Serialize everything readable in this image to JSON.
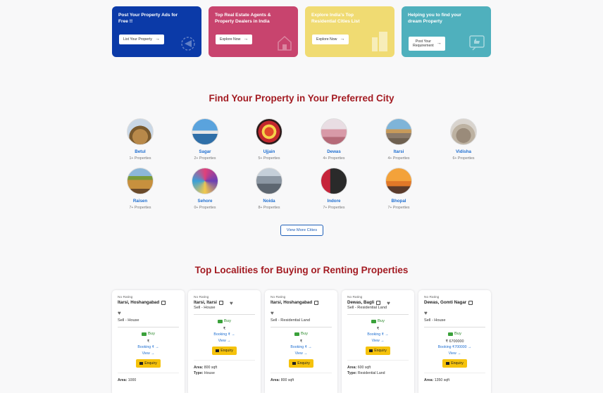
{
  "promos": [
    {
      "title": "Post Your Property Ads for Free !!",
      "button": "List Your Property",
      "color": "#0b3aa8"
    },
    {
      "title": "Top Real Estate Agents & Property Dealers in India",
      "button": "Explore Now",
      "color": "#c8446e"
    },
    {
      "title": "Explore India's Top Residential Cities List",
      "button": "Explore Now",
      "color": "#f0db72"
    },
    {
      "title": "Helping you to find your dream Property",
      "button": "Post Your Requirement",
      "color": "#4fb0bd"
    }
  ],
  "cities_section": {
    "title": "Find Your Property in Your Preferred City",
    "view_more": "View More Cities",
    "cities": [
      {
        "name": "Betul",
        "count": "1+ Properties"
      },
      {
        "name": "Sagar",
        "count": "2+ Properties"
      },
      {
        "name": "Ujjain",
        "count": "5+ Properties"
      },
      {
        "name": "Dewas",
        "count": "4+ Properties"
      },
      {
        "name": "Itarsi",
        "count": "4+ Properties"
      },
      {
        "name": "Vidisha",
        "count": "6+ Properties"
      },
      {
        "name": "Raisen",
        "count": "7+ Properties"
      },
      {
        "name": "Sehore",
        "count": "0+ Properties"
      },
      {
        "name": "Noida",
        "count": "8+ Properties"
      },
      {
        "name": "Indore",
        "count": "7+ Properties"
      },
      {
        "name": "Bhopal",
        "count": "7+ Properties"
      }
    ]
  },
  "localities_section": {
    "title": "Top Localities for Buying or Renting Properties",
    "cards": [
      {
        "rating": "No Rating",
        "location": "Itarsi, Hoshangabad",
        "type": "Sell - House",
        "buy": "Buy",
        "price": "₹",
        "booking": "Booking ₹",
        "view": "View",
        "enquiry": "Enquiry",
        "attr1_label": "Area:",
        "attr1_value": "1000",
        "attr2_label": "",
        "attr2_value": ""
      },
      {
        "rating": "No Rating",
        "location": "Itarsi, Itarsi",
        "type": "Sell - House",
        "buy": "Buy",
        "price": "₹",
        "booking": "Booking ₹",
        "view": "View",
        "enquiry": "Enquiry",
        "attr1_label": "Area:",
        "attr1_value": "800 sqft",
        "attr2_label": "Type:",
        "attr2_value": "House"
      },
      {
        "rating": "No Rating",
        "location": "Itarsi, Hoshangabad",
        "type": "Sell - Residential Land",
        "buy": "Buy",
        "price": "₹",
        "booking": "Booking ₹",
        "view": "View",
        "enquiry": "Enquiry",
        "attr1_label": "Area:",
        "attr1_value": "800 sqft",
        "attr2_label": "",
        "attr2_value": ""
      },
      {
        "rating": "No Rating",
        "location": "Dewas, Bagli",
        "type": "Sell - Residential Land",
        "buy": "Buy",
        "price": "₹",
        "booking": "Booking ₹",
        "view": "View",
        "enquiry": "Enquiry",
        "attr1_label": "Area:",
        "attr1_value": "600 sqft",
        "attr2_label": "Type:",
        "attr2_value": "Residential Land"
      },
      {
        "rating": "No Rating",
        "location": "Dewas, Gomti Nagar",
        "type": "Sell - House",
        "buy": "Buy",
        "price": "₹ 6700000",
        "booking": "Booking ₹700000",
        "view": "View",
        "enquiry": "Enquiry",
        "attr1_label": "Area:",
        "attr1_value": "1350 sqft",
        "attr2_label": "",
        "attr2_value": ""
      }
    ]
  }
}
